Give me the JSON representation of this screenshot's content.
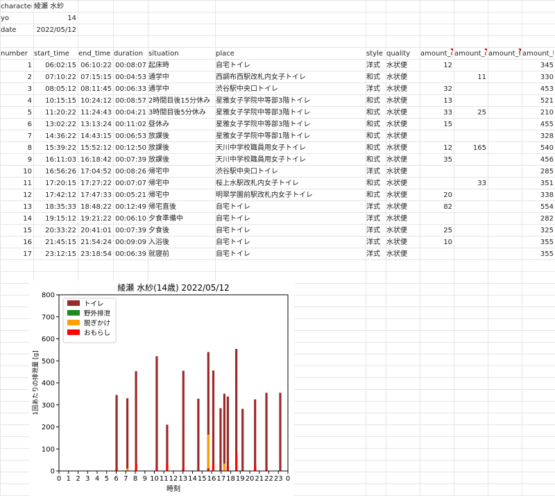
{
  "meta_rows": [
    {
      "label": "character",
      "value": "綾瀬 水紗",
      "align": "left"
    },
    {
      "label": "yo",
      "value": "14",
      "align": "right"
    },
    {
      "label": "date",
      "value": "2022/05/12",
      "align": "right"
    }
  ],
  "headers": [
    "number",
    "start_time",
    "end_time",
    "duration",
    "situation",
    "place",
    "style",
    "quality",
    "amount_c",
    "amount_o",
    "amount_f",
    "amount_t"
  ],
  "rows": [
    [
      "1",
      "06:02:15",
      "06:10:22",
      "00:08:07",
      "起床時",
      "自宅トイレ",
      "洋式",
      "水状便",
      "12",
      "",
      "",
      "345"
    ],
    [
      "2",
      "07:10:22",
      "07:15:15",
      "00:04:53",
      "通学中",
      "西調布西駅改札内女子トイレ",
      "和式",
      "水状便",
      "",
      "11",
      "",
      "330"
    ],
    [
      "3",
      "08:05:12",
      "08:11:45",
      "00:06:33",
      "通学中",
      "渋谷駅中央口トイレ",
      "洋式",
      "水状便",
      "32",
      "",
      "",
      "453"
    ],
    [
      "4",
      "10:15:15",
      "10:24:12",
      "00:08:57",
      "2時間目後15分休み",
      "星雅女子学院中等部3階トイレ",
      "和式",
      "水状便",
      "13",
      "",
      "",
      "521"
    ],
    [
      "5",
      "11:20:22",
      "11:24:43",
      "00:04:21",
      "3時間目後5分休み",
      "星雅女子学院中等部3階トイレ",
      "和式",
      "水状便",
      "33",
      "25",
      "",
      "210"
    ],
    [
      "6",
      "13:02:22",
      "13:13:24",
      "00:11:02",
      "昼休み",
      "星雅女子学院中等部3階トイレ",
      "和式",
      "水状便",
      "15",
      "",
      "",
      "455"
    ],
    [
      "7",
      "14:36:22",
      "14:43:15",
      "00:06:53",
      "放課後",
      "星雅女子学院中等部1階トイレ",
      "和式",
      "水状便",
      "",
      "",
      "",
      "328"
    ],
    [
      "8",
      "15:39:22",
      "15:52:12",
      "00:12:50",
      "放課後",
      "天川中学校職員用女子トイレ",
      "和式",
      "水状便",
      "12",
      "165",
      "",
      "540"
    ],
    [
      "9",
      "16:11:03",
      "16:18:42",
      "00:07:39",
      "放課後",
      "天川中学校職員用女子トイレ",
      "和式",
      "水状便",
      "35",
      "",
      "",
      "456"
    ],
    [
      "10",
      "16:56:26",
      "17:04:52",
      "00:08:26",
      "帰宅中",
      "渋谷駅中央口トイレ",
      "洋式",
      "水状便",
      "",
      "",
      "",
      "285"
    ],
    [
      "11",
      "17:20:15",
      "17:27:22",
      "00:07:07",
      "帰宅中",
      "桜上水駅改札内女子トイレ",
      "和式",
      "水状便",
      "",
      "33",
      "",
      "351"
    ],
    [
      "12",
      "17:42:12",
      "17:47:33",
      "00:05:21",
      "帰宅中",
      "明翠学園前駅改札内女子トイレ",
      "和式",
      "水状便",
      "20",
      "",
      "",
      "338"
    ],
    [
      "13",
      "18:35:33",
      "18:48:22",
      "00:12:49",
      "帰宅直後",
      "自宅トイレ",
      "洋式",
      "水状便",
      "82",
      "",
      "",
      "554"
    ],
    [
      "14",
      "19:15:12",
      "19:21:22",
      "00:06:10",
      "夕食準備中",
      "自宅トイレ",
      "洋式",
      "水状便",
      "",
      "",
      "",
      "282"
    ],
    [
      "15",
      "20:33:22",
      "20:41:01",
      "00:07:39",
      "夕食後",
      "自宅トイレ",
      "洋式",
      "水状便",
      "25",
      "",
      "",
      "325"
    ],
    [
      "16",
      "21:45:15",
      "21:54:24",
      "00:09:09",
      "入浴後",
      "自宅トイレ",
      "洋式",
      "水状便",
      "10",
      "",
      "",
      "355"
    ],
    [
      "17",
      "23:12:15",
      "23:18:54",
      "00:06:39",
      "就寝前",
      "自宅トイレ",
      "洋式",
      "水状便",
      "",
      "",
      "",
      "355"
    ]
  ],
  "chart_data": {
    "type": "bar",
    "stacked": true,
    "title": "綾瀬 水紗(14歳) 2022/05/12",
    "xlabel": "時刻",
    "ylabel": "1回あたりの排泄量 [g]",
    "xlim": [
      0,
      24
    ],
    "ylim": [
      0,
      800
    ],
    "xticks": [
      "0",
      "1",
      "2",
      "3",
      "4",
      "5",
      "6",
      "7",
      "8",
      "9",
      "10",
      "11",
      "12",
      "13",
      "14",
      "15",
      "16",
      "17",
      "18",
      "19",
      "20",
      "21",
      "22",
      "23",
      "0"
    ],
    "yticks": [
      0,
      100,
      200,
      300,
      400,
      500,
      600,
      700,
      800
    ],
    "legend_position": "top-left",
    "series": [
      {
        "name": "トイレ",
        "color": "#9b2a2a"
      },
      {
        "name": "野外排泄",
        "color": "#1a8a1a"
      },
      {
        "name": "脱ぎかけ",
        "color": "#ffa000"
      },
      {
        "name": "おもらし",
        "color": "#ff0000"
      }
    ],
    "bars": [
      {
        "x": 6.04,
        "toilet": 345,
        "outdoor": 0,
        "partial": 0,
        "accident": 12
      },
      {
        "x": 7.17,
        "toilet": 330,
        "outdoor": 0,
        "partial": 11,
        "accident": 0
      },
      {
        "x": 8.08,
        "toilet": 453,
        "outdoor": 0,
        "partial": 0,
        "accident": 32
      },
      {
        "x": 10.25,
        "toilet": 521,
        "outdoor": 0,
        "partial": 0,
        "accident": 13
      },
      {
        "x": 11.34,
        "toilet": 210,
        "outdoor": 0,
        "partial": 25,
        "accident": 33
      },
      {
        "x": 13.04,
        "toilet": 455,
        "outdoor": 0,
        "partial": 0,
        "accident": 15
      },
      {
        "x": 14.61,
        "toilet": 328,
        "outdoor": 0,
        "partial": 0,
        "accident": 0
      },
      {
        "x": 15.66,
        "toilet": 540,
        "outdoor": 0,
        "partial": 165,
        "accident": 12
      },
      {
        "x": 16.18,
        "toilet": 456,
        "outdoor": 0,
        "partial": 0,
        "accident": 35
      },
      {
        "x": 16.94,
        "toilet": 285,
        "outdoor": 0,
        "partial": 0,
        "accident": 0
      },
      {
        "x": 17.34,
        "toilet": 351,
        "outdoor": 0,
        "partial": 33,
        "accident": 0
      },
      {
        "x": 17.7,
        "toilet": 338,
        "outdoor": 0,
        "partial": 0,
        "accident": 20
      },
      {
        "x": 18.59,
        "toilet": 554,
        "outdoor": 0,
        "partial": 0,
        "accident": 82
      },
      {
        "x": 19.25,
        "toilet": 282,
        "outdoor": 0,
        "partial": 0,
        "accident": 0
      },
      {
        "x": 20.56,
        "toilet": 325,
        "outdoor": 0,
        "partial": 0,
        "accident": 25
      },
      {
        "x": 21.75,
        "toilet": 355,
        "outdoor": 0,
        "partial": 0,
        "accident": 10
      },
      {
        "x": 23.2,
        "toilet": 355,
        "outdoor": 0,
        "partial": 0,
        "accident": 0
      }
    ]
  }
}
